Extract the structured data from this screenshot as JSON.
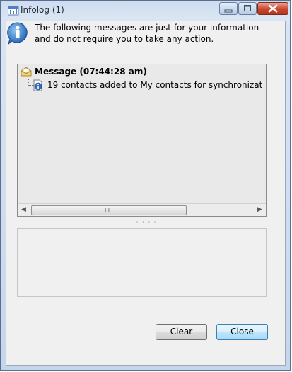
{
  "window": {
    "title": "Infolog (1)"
  },
  "header": {
    "message": "The following messages are just for your information and do not require you to take any action."
  },
  "tree": {
    "group_label": "Message (07:44:28 am)",
    "items": [
      {
        "text": "19 contacts added to My contacts for synchronizat"
      }
    ]
  },
  "scrollbar": {
    "left_arrow": "◀",
    "right_arrow": "▶",
    "grip": "III"
  },
  "buttons": {
    "clear_label": "Clear",
    "close_label": "Close"
  },
  "colors": {
    "title_bar": "#cddcef",
    "close_button": "#c9452c",
    "client_bg": "#f0f0f0"
  }
}
